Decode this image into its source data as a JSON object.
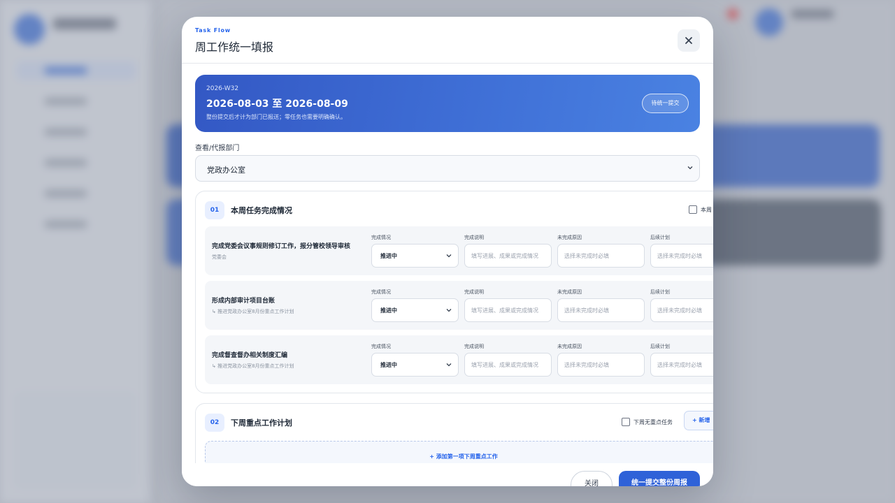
{
  "modal": {
    "brand": "Task Flow",
    "title": "周工作统一填报",
    "close_icon": "close-icon"
  },
  "week": {
    "code": "2026-W32",
    "range": "2026-08-03 至 2026-08-09",
    "note": "整份提交后才计为部门已报送；零任务也需要明确确认。",
    "status": "待统一提交"
  },
  "department": {
    "label": "查看/代报部门",
    "selected": "党政办公室"
  },
  "section1": {
    "number": "01",
    "title": "本周任务完成情况",
    "checkbox_label": "本周",
    "tasks": [
      {
        "name": "完成党委会议事规则修订工作，报分管校领导审核",
        "sub": "党委会",
        "status_label": "完成情况",
        "status": "推进中",
        "desc_label": "完成说明",
        "desc_placeholder": "填写进展、成果或完成情况",
        "reason_label": "未完成原因",
        "reason_placeholder": "选择未完成时必填",
        "plan_label": "后续计划",
        "plan_placeholder": "选择未完成时必填"
      },
      {
        "name": "形成内部审计项目台账",
        "sub": "↳ 推进党政办公室8月份重点工作计划",
        "status_label": "完成情况",
        "status": "推进中",
        "desc_label": "完成说明",
        "desc_placeholder": "填写进展、成果或完成情况",
        "reason_label": "未完成原因",
        "reason_placeholder": "选择未完成时必填",
        "plan_label": "后续计划",
        "plan_placeholder": "选择未完成时必填"
      },
      {
        "name": "完成督查督办相关制度汇编",
        "sub": "↳ 推进党政办公室8月份重点工作计划",
        "status_label": "完成情况",
        "status": "推进中",
        "desc_label": "完成说明",
        "desc_placeholder": "填写进展、成果或完成情况",
        "reason_label": "未完成原因",
        "reason_placeholder": "选择未完成时必填",
        "plan_label": "后续计划",
        "plan_placeholder": "选择未完成时必填"
      }
    ]
  },
  "section2": {
    "number": "02",
    "title": "下周重点工作计划",
    "checkbox_label": "下周无重点任务",
    "add_label": "+ 新增",
    "add_first_label": "+ 添加第一项下周重点工作"
  },
  "footer": {
    "close_label": "关闭",
    "submit_label": "统一提交整份周报"
  },
  "colors": {
    "accent": "#2f62d8",
    "hero_start": "#3358c4",
    "hero_end": "#4a82e2"
  }
}
